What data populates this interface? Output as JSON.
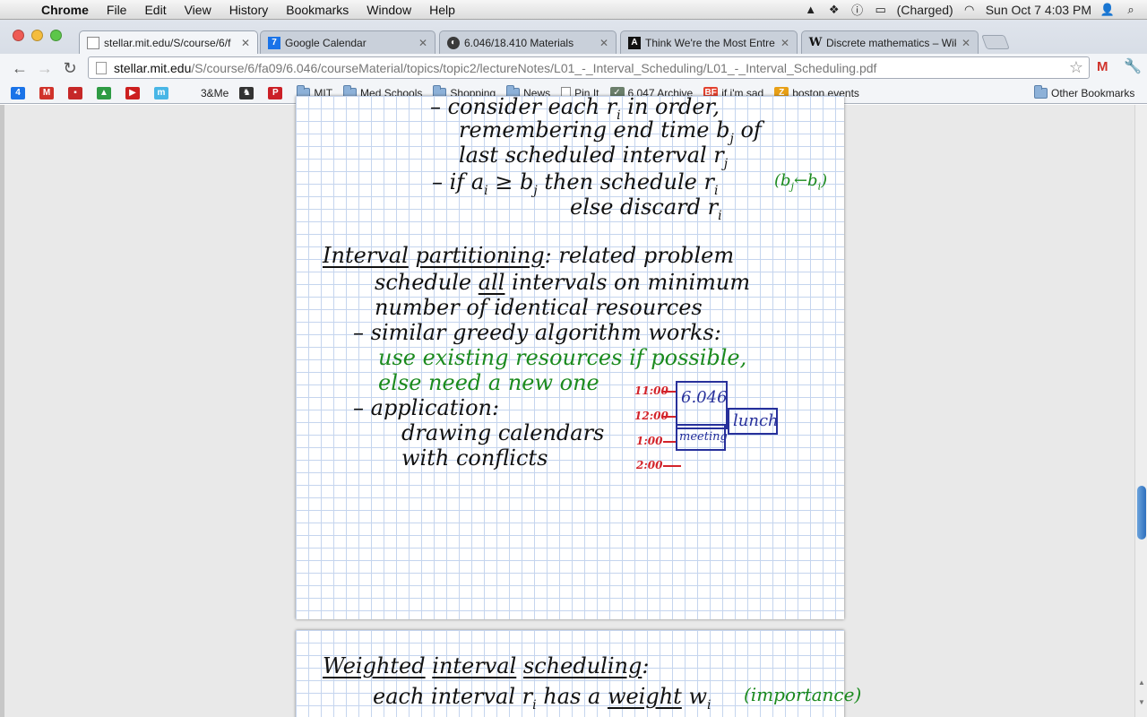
{
  "menubar": {
    "app": "Chrome",
    "items": [
      "File",
      "Edit",
      "View",
      "History",
      "Bookmarks",
      "Window",
      "Help"
    ],
    "battery": "(Charged)",
    "clock": "Sun Oct 7  4:03 PM"
  },
  "tabs": [
    {
      "title": "stellar.mit.edu/S/course/6/f",
      "favicon": "page-icon",
      "active": true
    },
    {
      "title": "Google Calendar",
      "favicon": "calendar-icon",
      "badge": "7"
    },
    {
      "title": "6.046/18.410 Materials",
      "favicon": "mit-icon"
    },
    {
      "title": "Think We're the Most Entrep",
      "favicon": "atlantic-icon",
      "badge": "A"
    },
    {
      "title": "Discrete mathematics – Wiki",
      "favicon": "wikipedia-icon",
      "badge": "W"
    }
  ],
  "omnibox": {
    "host": "stellar.mit.edu",
    "path": "/S/course/6/fa09/6.046/courseMaterial/topics/topic2/lectureNotes/L01_-_Interval_Scheduling/L01_-_Interval_Scheduling.pdf"
  },
  "bookmarks": [
    {
      "label": "",
      "icon": "calendar-bm-icon",
      "badge": "4",
      "color": "#1a73e8"
    },
    {
      "label": "",
      "icon": "gmail-bm-icon",
      "badge": "M",
      "color": "#d0332b"
    },
    {
      "label": "",
      "icon": "news-bm-icon",
      "badge": "▪",
      "color": "#c62828"
    },
    {
      "label": "",
      "icon": "drive-bm-icon",
      "badge": "▲",
      "color": "#2e9b44"
    },
    {
      "label": "",
      "icon": "youtube-bm-icon",
      "badge": "▶",
      "color": "#cc1f1f"
    },
    {
      "label": "",
      "icon": "m-bm-icon",
      "badge": "m",
      "color": "#48b6e6"
    },
    {
      "label": "3&Me",
      "icon": "none"
    },
    {
      "label": "",
      "icon": "horse-bm-icon",
      "badge": "♞",
      "color": "#333333"
    },
    {
      "label": "",
      "icon": "pinterest-bm-icon",
      "badge": "P",
      "color": "#cb2027"
    },
    {
      "label": "MIT",
      "icon": "folder"
    },
    {
      "label": "Med Schools",
      "icon": "folder"
    },
    {
      "label": "Shopping",
      "icon": "folder"
    },
    {
      "label": "News",
      "icon": "folder"
    },
    {
      "label": "Pin It",
      "icon": "page"
    },
    {
      "label": "6.047 Archive",
      "icon": "shield-bm-icon",
      "badge": "✓",
      "color": "#6b7f6b"
    },
    {
      "label": "if i'm sad",
      "icon": "bf-bm-icon",
      "badge": "BF",
      "color": "#e2412e"
    },
    {
      "label": "boston events",
      "icon": "z-bm-icon",
      "badge": "Z",
      "color": "#e8a017"
    }
  ],
  "other_bookmarks": "Other Bookmarks",
  "notes": {
    "l1": "– consider each r",
    "l2": "remembering end time b",
    "l3": "last scheduled interval r",
    "l4": "– if a",
    "l4b": "then schedule r",
    "l4note": "(b",
    "l5": "else discard r",
    "p_title1": "Interval",
    "p_title2": "partitioning",
    "p_title3": ":  related problem",
    "p2a": "schedule",
    "p2b": "all",
    "p2c": "intervals on minimum",
    "p3": "number of  identical resources",
    "p4": "– similar greedy algorithm works:",
    "p5": "use existing resources if possible,",
    "p6": "else need a new one",
    "p7": "– application:",
    "p8": "drawing calendars",
    "p9": "with conflicts",
    "times": [
      "11:00",
      "12:00",
      "1:00",
      "2:00"
    ],
    "cal_6046": "6.046",
    "cal_lunch": "lunch",
    "cal_meeting": "meeting",
    "w_title1": "Weighted",
    "w_title2": "interval",
    "w_title3": "scheduling",
    "w_colon": ":",
    "w1a": "each  interval  r",
    "w1b": "has a",
    "w1c": "weight",
    "w1d": "w",
    "w1note": "(importance)"
  }
}
